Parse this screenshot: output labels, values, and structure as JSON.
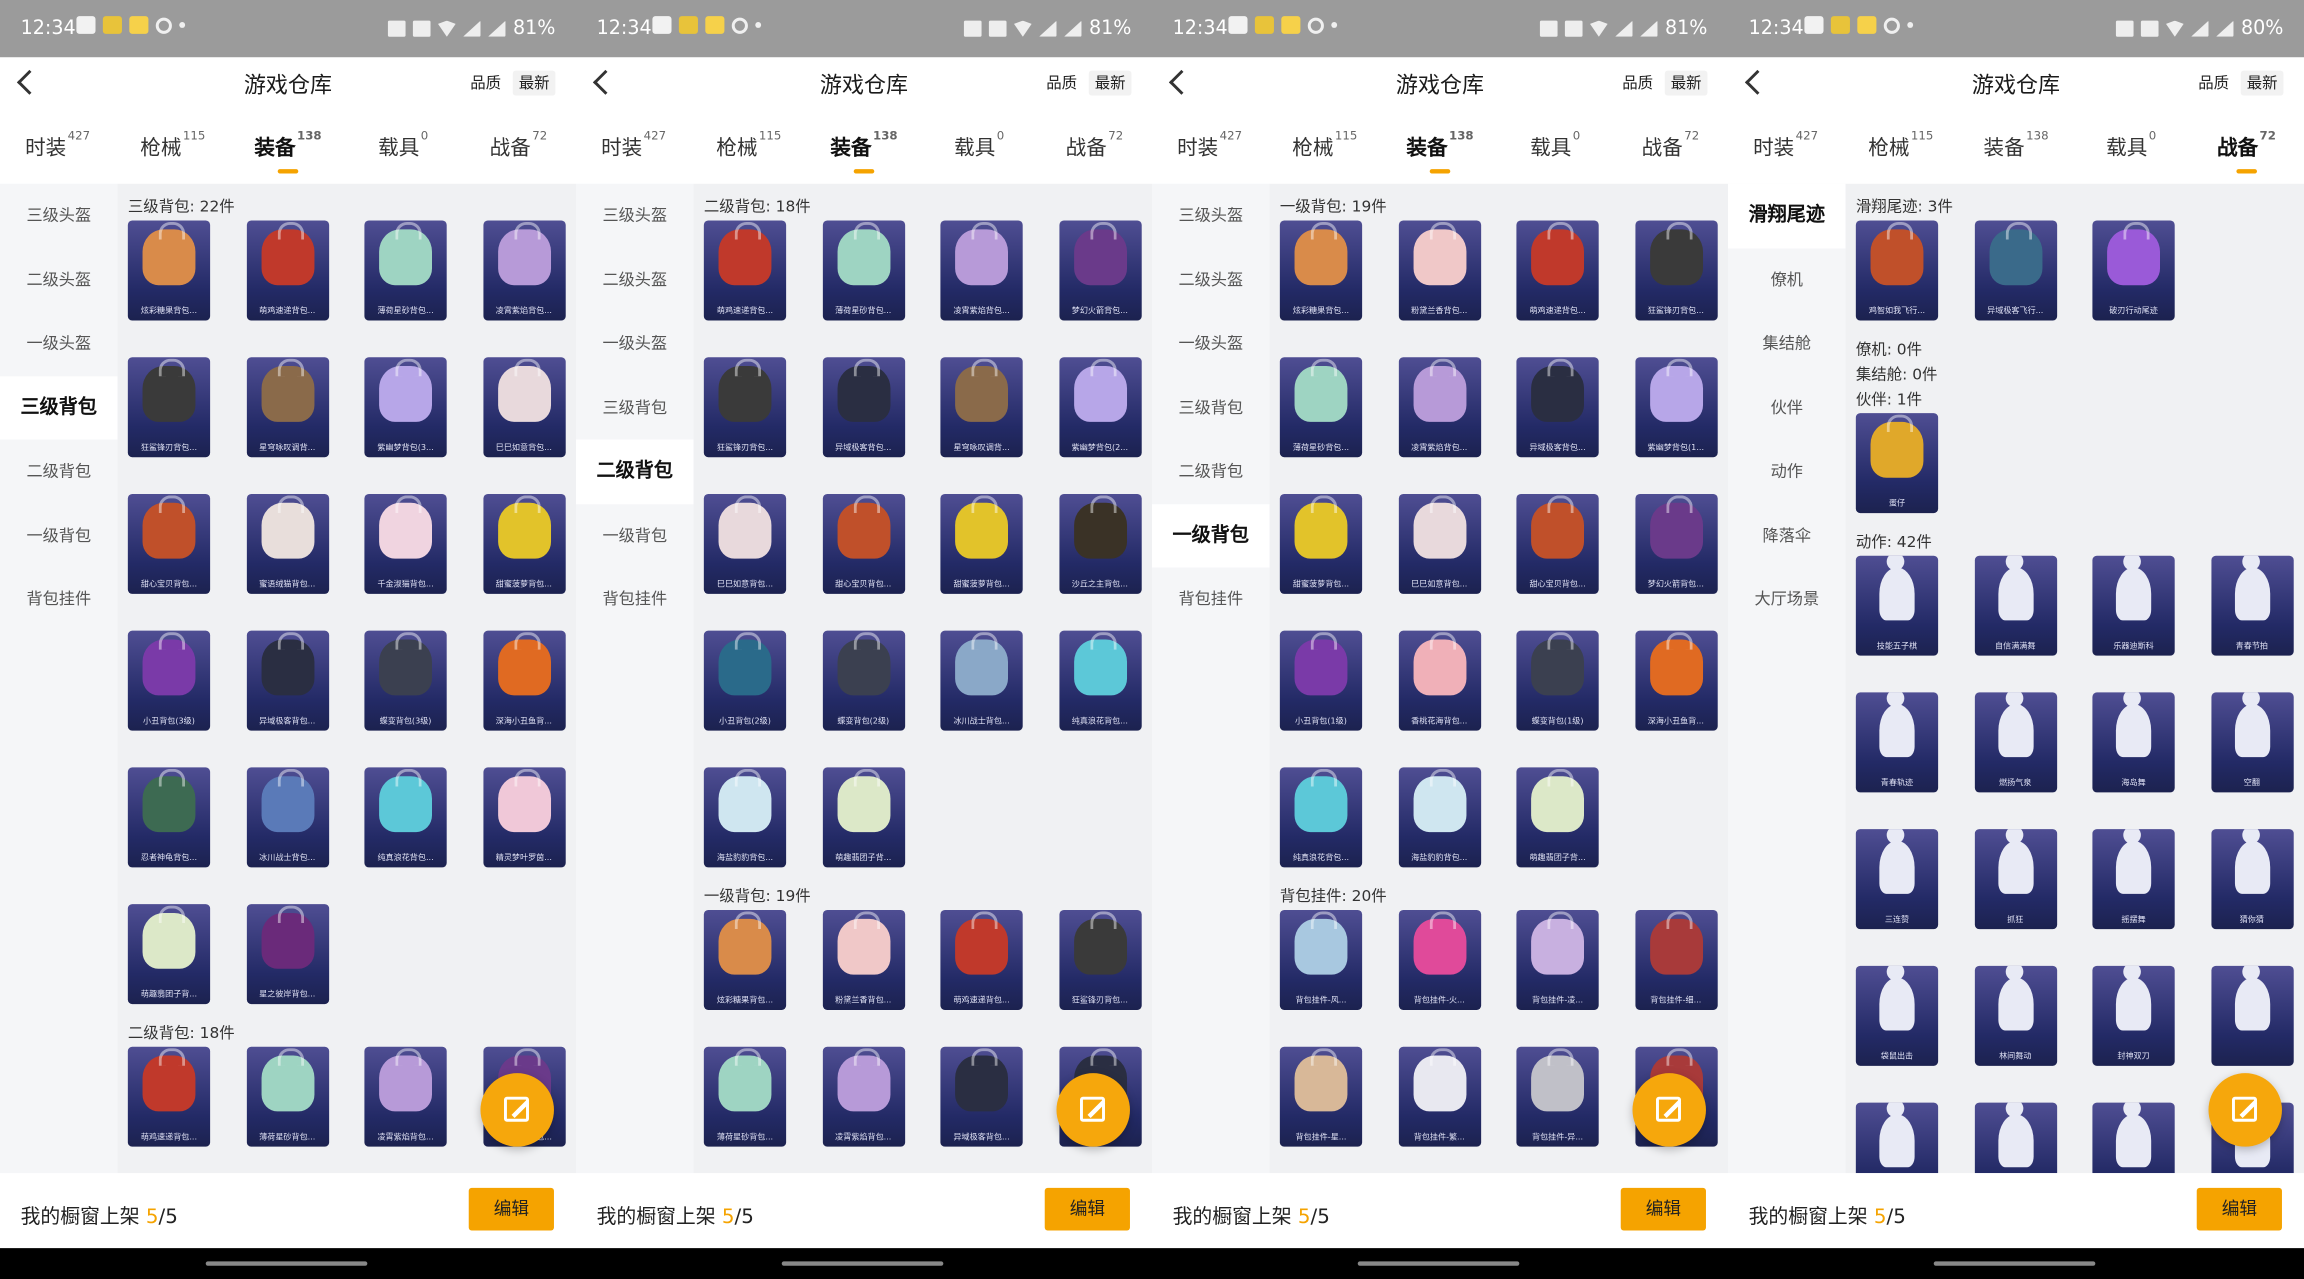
{
  "panels": [
    {
      "status": {
        "time": "12:34",
        "battery": "81%"
      },
      "title": "游戏仓库",
      "sort": [
        "品质",
        "最新"
      ],
      "tabs": [
        {
          "label": "时装",
          "count": "427",
          "active": false
        },
        {
          "label": "枪械",
          "count": "115",
          "active": false
        },
        {
          "label": "装备",
          "count": "138",
          "active": true
        },
        {
          "label": "载具",
          "count": "0",
          "active": false
        },
        {
          "label": "战备",
          "count": "72",
          "active": false
        }
      ],
      "sidebar": [
        {
          "label": "三级头盔",
          "active": false
        },
        {
          "label": "二级头盔",
          "active": false
        },
        {
          "label": "一级头盔",
          "active": false
        },
        {
          "label": "三级背包",
          "active": true
        },
        {
          "label": "二级背包",
          "active": false
        },
        {
          "label": "一级背包",
          "active": false
        },
        {
          "label": "背包挂件",
          "active": false
        }
      ],
      "sections": [
        {
          "title": "三级背包: 22件",
          "items": [
            {
              "name": "炫彩糖果背包...",
              "color": "#d98b4a"
            },
            {
              "name": "萌鸡速递背包...",
              "color": "#c0392b"
            },
            {
              "name": "薄荷星砂背包...",
              "color": "#9ed4c2"
            },
            {
              "name": "凌霄紫焰背包...",
              "color": "#b79ad8"
            },
            {
              "name": "狂鲨锋刃背包...",
              "color": "#3a3a3a"
            },
            {
              "name": "星穹咏叹调背...",
              "color": "#8a6a4a"
            },
            {
              "name": "紫幽梦背包(3...",
              "color": "#b7a6e8"
            },
            {
              "name": "巳巳如意背包...",
              "color": "#e8d9dc"
            },
            {
              "name": "甜心宝贝背包...",
              "color": "#c0502a"
            },
            {
              "name": "蜜语绒猫背包...",
              "color": "#e8dedb"
            },
            {
              "name": "千金淑猫背包...",
              "color": "#f0d4e0"
            },
            {
              "name": "甜蜜菠萝背包...",
              "color": "#e2c32a"
            },
            {
              "name": "小丑背包(3级)",
              "color": "#7a3aa8"
            },
            {
              "name": "异域极客背包...",
              "color": "#2a2e42"
            },
            {
              "name": "蝶变背包(3级)",
              "color": "#3b4050"
            },
            {
              "name": "深海小丑鱼背...",
              "color": "#e06a22"
            },
            {
              "name": "忍者神龟背包...",
              "color": "#3d6a52"
            },
            {
              "name": "冰川战士背包...",
              "color": "#5a7ab8"
            },
            {
              "name": "纯真浪花背包...",
              "color": "#5cc8d8"
            },
            {
              "name": "精灵梦叶罗茵...",
              "color": "#f0c8d8"
            },
            {
              "name": "萌趣翡团子背...",
              "color": "#dce8c8"
            },
            {
              "name": "星之彼岸背包...",
              "color": "#6a2a7a"
            }
          ]
        },
        {
          "title": "二级背包: 18件",
          "items": [
            {
              "name": "萌鸡速递背包...",
              "color": "#c0392b"
            },
            {
              "name": "薄荷星砂背包...",
              "color": "#9ed4c2"
            },
            {
              "name": "凌霄紫焰背包...",
              "color": "#b79ad8"
            },
            {
              "name": "梦幻火箭背包...",
              "color": "#6a3a8a"
            }
          ]
        }
      ]
    },
    {
      "status": {
        "time": "12:34",
        "battery": "81%"
      },
      "title": "游戏仓库",
      "sort": [
        "品质",
        "最新"
      ],
      "tabs": [
        {
          "label": "时装",
          "count": "427",
          "active": false
        },
        {
          "label": "枪械",
          "count": "115",
          "active": false
        },
        {
          "label": "装备",
          "count": "138",
          "active": true
        },
        {
          "label": "载具",
          "count": "0",
          "active": false
        },
        {
          "label": "战备",
          "count": "72",
          "active": false
        }
      ],
      "sidebar": [
        {
          "label": "三级头盔",
          "active": false
        },
        {
          "label": "二级头盔",
          "active": false
        },
        {
          "label": "一级头盔",
          "active": false
        },
        {
          "label": "三级背包",
          "active": false
        },
        {
          "label": "二级背包",
          "active": true
        },
        {
          "label": "一级背包",
          "active": false
        },
        {
          "label": "背包挂件",
          "active": false
        }
      ],
      "sections": [
        {
          "title": "二级背包: 18件",
          "items": [
            {
              "name": "萌鸡速递背包...",
              "color": "#c0392b"
            },
            {
              "name": "薄荷星砂背包...",
              "color": "#9ed4c2"
            },
            {
              "name": "凌霄紫焰背包...",
              "color": "#b79ad8"
            },
            {
              "name": "梦幻火箭背包...",
              "color": "#6a3a8a"
            },
            {
              "name": "狂鲨锋刃背包...",
              "color": "#3a3a3a"
            },
            {
              "name": "异域极客背包...",
              "color": "#2a2e42"
            },
            {
              "name": "星穹咏叹调背...",
              "color": "#8a6a4a"
            },
            {
              "name": "紫幽梦背包(2...",
              "color": "#b7a6e8"
            },
            {
              "name": "巳巳如意背包...",
              "color": "#e8d9dc"
            },
            {
              "name": "甜心宝贝背包...",
              "color": "#c0502a"
            },
            {
              "name": "甜蜜菠萝背包...",
              "color": "#e2c32a"
            },
            {
              "name": "沙丘之主背包...",
              "color": "#3a3226"
            },
            {
              "name": "小丑背包(2级)",
              "color": "#2a6a8a"
            },
            {
              "name": "蝶变背包(2级)",
              "color": "#3b4050"
            },
            {
              "name": "冰川战士背包...",
              "color": "#8aa8c8"
            },
            {
              "name": "纯真浪花背包...",
              "color": "#5cc8d8"
            },
            {
              "name": "海盐豹豹背包...",
              "color": "#cfe6f0"
            },
            {
              "name": "萌趣翡团子背...",
              "color": "#dce8c8"
            }
          ]
        },
        {
          "title": "一级背包: 19件",
          "items": [
            {
              "name": "炫彩糖果背包...",
              "color": "#d98b4a"
            },
            {
              "name": "粉黛兰香背包...",
              "color": "#f0c8c8"
            },
            {
              "name": "萌鸡速递背包...",
              "color": "#c0392b"
            },
            {
              "name": "狂鲨锋刃背包...",
              "color": "#3a3a3a"
            },
            {
              "name": "薄荷星砂背包...",
              "color": "#9ed4c2"
            },
            {
              "name": "凌霄紫焰背包...",
              "color": "#b79ad8"
            },
            {
              "name": "异域极客背包...",
              "color": "#2a2e42"
            },
            {
              "name": "",
              "color": "#2a2e42"
            }
          ]
        }
      ]
    },
    {
      "status": {
        "time": "12:34",
        "battery": "81%"
      },
      "title": "游戏仓库",
      "sort": [
        "品质",
        "最新"
      ],
      "tabs": [
        {
          "label": "时装",
          "count": "427",
          "active": false
        },
        {
          "label": "枪械",
          "count": "115",
          "active": false
        },
        {
          "label": "装备",
          "count": "138",
          "active": true
        },
        {
          "label": "载具",
          "count": "0",
          "active": false
        },
        {
          "label": "战备",
          "count": "72",
          "active": false
        }
      ],
      "sidebar": [
        {
          "label": "三级头盔",
          "active": false
        },
        {
          "label": "二级头盔",
          "active": false
        },
        {
          "label": "一级头盔",
          "active": false
        },
        {
          "label": "三级背包",
          "active": false
        },
        {
          "label": "二级背包",
          "active": false
        },
        {
          "label": "一级背包",
          "active": true
        },
        {
          "label": "背包挂件",
          "active": false
        }
      ],
      "sections": [
        {
          "title": "一级背包: 19件",
          "items": [
            {
              "name": "炫彩糖果背包...",
              "color": "#d98b4a"
            },
            {
              "name": "粉黛兰香背包...",
              "color": "#f0c8c8"
            },
            {
              "name": "萌鸡速递背包...",
              "color": "#c0392b"
            },
            {
              "name": "狂鲨锋刃背包...",
              "color": "#3a3a3a"
            },
            {
              "name": "薄荷星砂背包...",
              "color": "#9ed4c2"
            },
            {
              "name": "凌霄紫焰背包...",
              "color": "#b79ad8"
            },
            {
              "name": "异域极客背包...",
              "color": "#2a2e42"
            },
            {
              "name": "紫幽梦背包(1...",
              "color": "#b7a6e8"
            },
            {
              "name": "甜蜜菠萝背包...",
              "color": "#e2c32a"
            },
            {
              "name": "巳巳如意背包...",
              "color": "#e8d9dc"
            },
            {
              "name": "甜心宝贝背包...",
              "color": "#c0502a"
            },
            {
              "name": "梦幻火箭背包...",
              "color": "#6a3a8a"
            },
            {
              "name": "小丑背包(1级)",
              "color": "#7a3aa8"
            },
            {
              "name": "香桃花海背包...",
              "color": "#f0b0b8"
            },
            {
              "name": "蝶变背包(1级)",
              "color": "#3b4050"
            },
            {
              "name": "深海小丑鱼背...",
              "color": "#e06a22"
            },
            {
              "name": "纯真浪花背包...",
              "color": "#5cc8d8"
            },
            {
              "name": "海盐豹豹背包...",
              "color": "#cfe6f0"
            },
            {
              "name": "萌趣翡团子背...",
              "color": "#dce8c8"
            }
          ]
        },
        {
          "title": "背包挂件: 20件",
          "items": [
            {
              "name": "背包挂件-风...",
              "color": "#a8c8e0"
            },
            {
              "name": "背包挂件-火...",
              "color": "#e04a9a"
            },
            {
              "name": "背包挂件-凌...",
              "color": "#c8b0e0"
            },
            {
              "name": "背包挂件-细...",
              "color": "#a83a3a"
            },
            {
              "name": "背包挂件-星...",
              "color": "#d8b898"
            },
            {
              "name": "背包挂件-繁...",
              "color": "#e8e8f0"
            },
            {
              "name": "背包挂件-异...",
              "color": "#c0c0c8"
            },
            {
              "name": "",
              "color": "#a83a3a"
            }
          ]
        }
      ]
    },
    {
      "status": {
        "time": "12:34",
        "battery": "80%"
      },
      "title": "游戏仓库",
      "sort": [
        "品质",
        "最新"
      ],
      "tabs": [
        {
          "label": "时装",
          "count": "427",
          "active": false
        },
        {
          "label": "枪械",
          "count": "115",
          "active": false
        },
        {
          "label": "装备",
          "count": "138",
          "active": false
        },
        {
          "label": "载具",
          "count": "0",
          "active": false
        },
        {
          "label": "战备",
          "count": "72",
          "active": true
        }
      ],
      "sidebar": [
        {
          "label": "滑翔尾迹",
          "active": true
        },
        {
          "label": "僚机",
          "active": false
        },
        {
          "label": "集结舱",
          "active": false
        },
        {
          "label": "伙伴",
          "active": false
        },
        {
          "label": "动作",
          "active": false
        },
        {
          "label": "降落伞",
          "active": false
        },
        {
          "label": "大厅场景",
          "active": false
        }
      ],
      "sections": [
        {
          "title": "滑翔尾迹: 3件",
          "items": [
            {
              "name": "鸡智如我飞行...",
              "color": "#c0502a"
            },
            {
              "name": "异域极客飞行...",
              "color": "#3a6a8a"
            },
            {
              "name": "破刃行动尾迹",
              "color": "#9a5ad8"
            }
          ]
        },
        {
          "title": "僚机: 0件",
          "items": []
        },
        {
          "title": "集结舱: 0件",
          "items": []
        },
        {
          "title": "伙伴: 1件",
          "items": [
            {
              "name": "蛋仔",
              "color": "#e0a82a"
            }
          ]
        },
        {
          "title": "动作: 42件",
          "emote": true,
          "items": [
            {
              "name": "技能五子棋",
              "color": "#e8eaf5"
            },
            {
              "name": "自信满满舞",
              "color": "#e8eaf5"
            },
            {
              "name": "乐器迪斯科",
              "color": "#e8eaf5"
            },
            {
              "name": "青春节拍",
              "color": "#e8eaf5"
            },
            {
              "name": "青春轨迹",
              "color": "#e8eaf5"
            },
            {
              "name": "燃扬气泉",
              "color": "#e8eaf5"
            },
            {
              "name": "海岛舞",
              "color": "#e8eaf5"
            },
            {
              "name": "空翻",
              "color": "#e8eaf5"
            },
            {
              "name": "三连赞",
              "color": "#e8eaf5"
            },
            {
              "name": "抓狂",
              "color": "#e8eaf5"
            },
            {
              "name": "摇摆舞",
              "color": "#e8eaf5"
            },
            {
              "name": "猜你猜",
              "color": "#e8eaf5"
            },
            {
              "name": "袋鼠出击",
              "color": "#e8eaf5"
            },
            {
              "name": "林间舞动",
              "color": "#e8eaf5"
            },
            {
              "name": "封神双刀",
              "color": "#e8eaf5"
            },
            {
              "name": "",
              "color": "#e8eaf5"
            },
            {
              "name": "",
              "color": "#e8eaf5"
            },
            {
              "name": "",
              "color": "#e8eaf5"
            },
            {
              "name": "",
              "color": "#e8eaf5"
            },
            {
              "name": "",
              "color": "#e8eaf5"
            }
          ]
        }
      ]
    }
  ],
  "footer": {
    "label": "我的橱窗上架",
    "current": "5",
    "total": "/5",
    "edit": "编辑"
  },
  "accent": "#f5a300"
}
